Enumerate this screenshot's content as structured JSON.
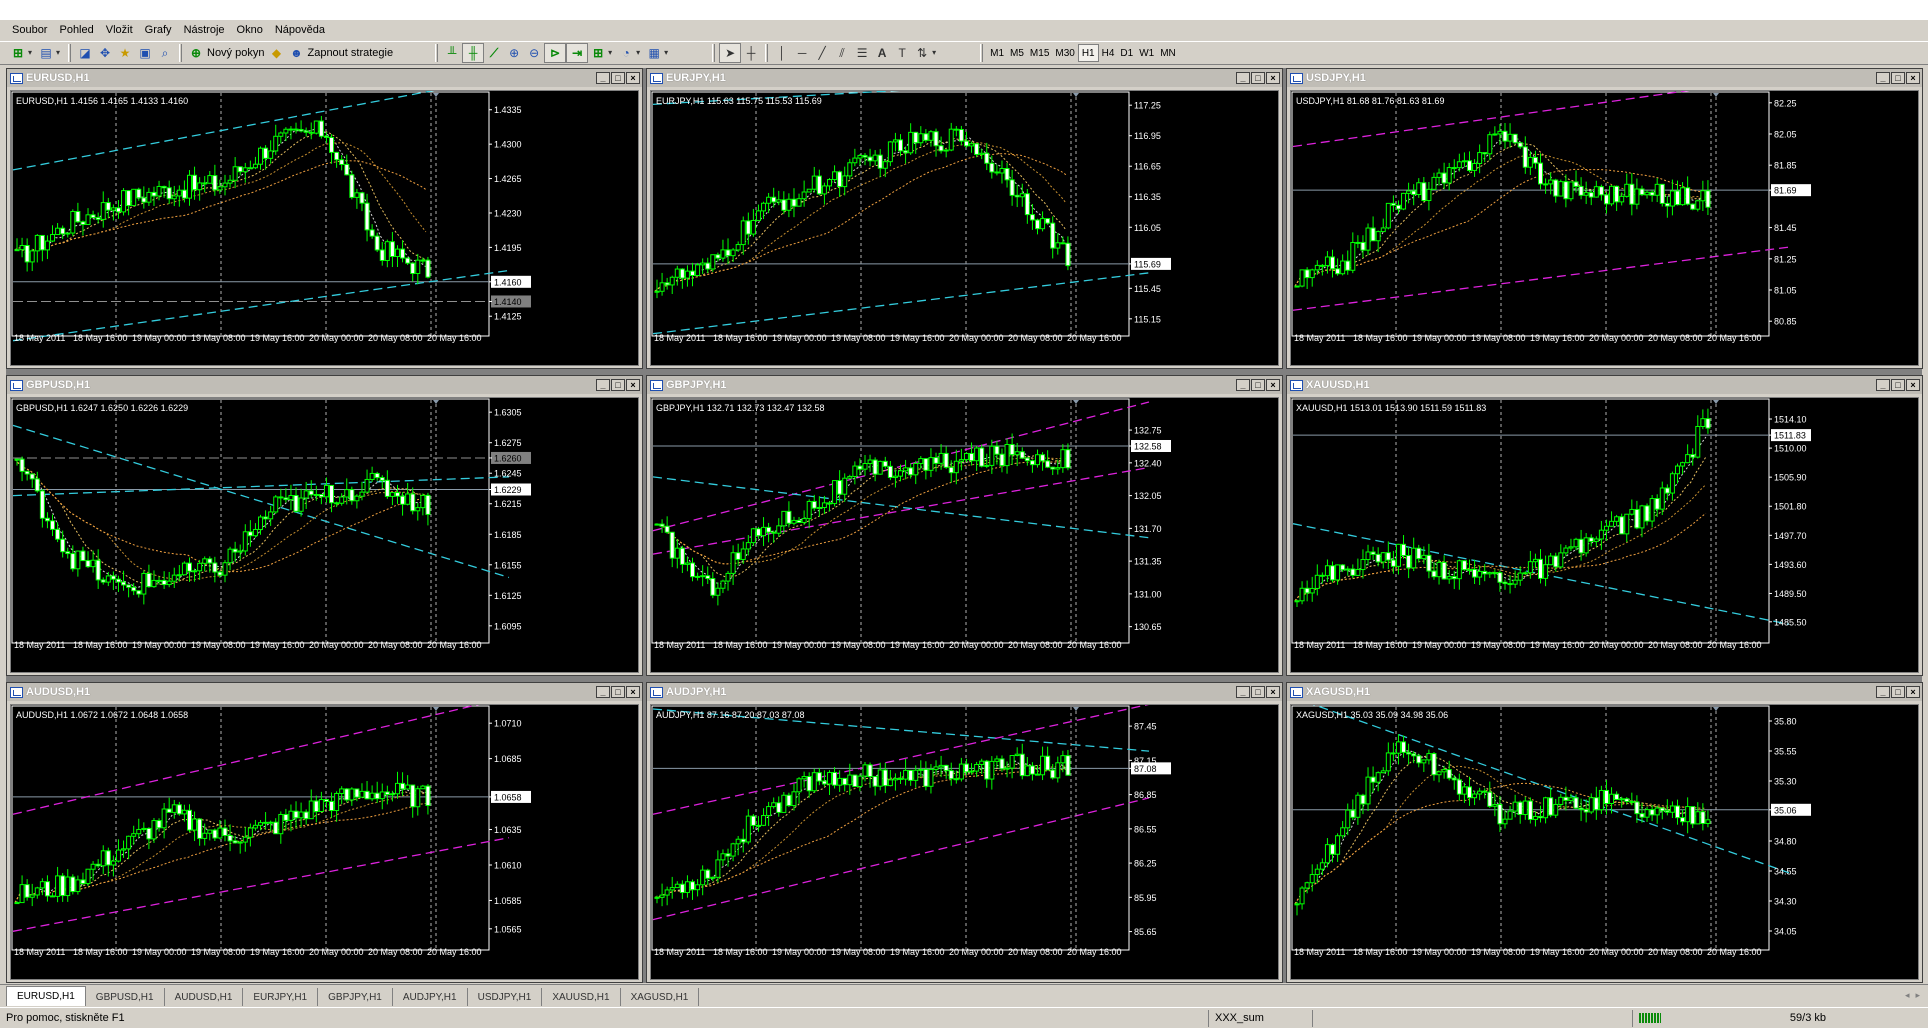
{
  "menu": [
    "Soubor",
    "Pohled",
    "Vložit",
    "Grafy",
    "Nástroje",
    "Okno",
    "Nápověda"
  ],
  "toolbar": {
    "new_order_label": "Nový pokyn",
    "strategies_label": "Zapnout strategie",
    "timeframes": [
      "M1",
      "M5",
      "M15",
      "M30",
      "H1",
      "H4",
      "D1",
      "W1",
      "MN"
    ],
    "active_timeframe": "H1"
  },
  "charts": [
    {
      "name": "EURUSD,H1",
      "header": "EURUSD,H1  1.4156 1.4165 1.4133 1.4160",
      "price_labels": [
        "1.4335",
        "1.4300",
        "1.4265",
        "1.4230",
        "1.4195",
        "1.4160",
        "1.4140",
        "1.4125"
      ],
      "current": "1.4160",
      "marker": "1.4140",
      "ymin": 1.4112,
      "ymax": 1.435,
      "trend": [
        0.3,
        0.45,
        0.55,
        0.6,
        0.62,
        0.8,
        0.85,
        0.35,
        0.25
      ],
      "lines": [
        {
          "type": "cyan",
          "y0": 0.68,
          "y1": 1.08
        },
        {
          "type": "cyan",
          "y0": -0.05,
          "y1": 0.25
        }
      ],
      "dates": [
        "18 May 2011",
        "18 May 16:00",
        "19 May 00:00",
        "19 May 08:00",
        "19 May 16:00",
        "20 May 00:00",
        "20 May 08:00",
        "20 May 16:00"
      ]
    },
    {
      "name": "EURJPY,H1",
      "header": "EURJPY,H1  115.63 115.75 115.53 115.69",
      "price_labels": [
        "117.25",
        "116.95",
        "116.65",
        "116.35",
        "116.05",
        "115.69",
        "115.45",
        "115.15"
      ],
      "current": "115.69",
      "marker": "",
      "ymin": 115.05,
      "ymax": 117.35,
      "trend": [
        0.2,
        0.25,
        0.5,
        0.6,
        0.7,
        0.8,
        0.82,
        0.6,
        0.3
      ],
      "lines": [
        {
          "type": "cyan",
          "y0": -0.02,
          "y1": 0.24
        },
        {
          "type": "cyan",
          "y0": 0.96,
          "y1": 1.08
        }
      ],
      "dates": [
        "18 May 2011",
        "18 May 16:00",
        "19 May 00:00",
        "19 May 08:00",
        "19 May 16:00",
        "20 May 00:00",
        "20 May 08:00",
        "20 May 16:00"
      ]
    },
    {
      "name": "USDJPY,H1",
      "header": "USDJPY,H1  81.68 81.76 81.63 81.69",
      "price_labels": [
        "82.25",
        "82.05",
        "81.85",
        "81.69",
        "81.45",
        "81.25",
        "81.05",
        "80.85"
      ],
      "current": "81.69",
      "marker": "",
      "ymin": 80.8,
      "ymax": 82.3,
      "trend": [
        0.2,
        0.3,
        0.55,
        0.65,
        0.85,
        0.6,
        0.58,
        0.57,
        0.55
      ],
      "lines": [
        {
          "type": "magenta",
          "y0": 0.78,
          "y1": 1.08
        },
        {
          "type": "magenta",
          "y0": 0.08,
          "y1": 0.35
        }
      ],
      "dates": [
        "18 May 2011",
        "18 May 16:00",
        "19 May 00:00",
        "19 May 08:00",
        "19 May 16:00",
        "20 May 00:00",
        "20 May 08:00",
        "20 May 16:00"
      ]
    },
    {
      "name": "GBPUSD,H1",
      "header": "GBPUSD,H1  1.6247 1.6250 1.6226 1.6229",
      "price_labels": [
        "1.6305",
        "1.6275",
        "1.6260",
        "1.6245",
        "1.6229",
        "1.6215",
        "1.6185",
        "1.6155",
        "1.6125",
        "1.6095"
      ],
      "current": "1.6229",
      "marker": "1.6260",
      "ymin": 1.6085,
      "ymax": 1.6315,
      "trend": [
        0.75,
        0.35,
        0.2,
        0.25,
        0.3,
        0.55,
        0.6,
        0.65,
        0.55
      ],
      "lines": [
        {
          "type": "cyan",
          "y0": 0.6,
          "y1": 0.68
        },
        {
          "type": "cyan",
          "y0": 0.9,
          "y1": 0.25
        }
      ],
      "dates": [
        "18 May 2011",
        "18 May 16:00",
        "19 May 00:00",
        "19 May 08:00",
        "19 May 16:00",
        "20 May 00:00",
        "20 May 08:00",
        "20 May 16:00"
      ]
    },
    {
      "name": "GBPJPY,H1",
      "header": "GBPJPY,H1  132.71 132.73 132.47 132.58",
      "price_labels": [
        "132.75",
        "132.58",
        "132.40",
        "132.05",
        "131.70",
        "131.35",
        "131.00",
        "130.65"
      ],
      "current": "132.58",
      "marker": "",
      "ymin": 130.55,
      "ymax": 133.05,
      "trend": [
        0.45,
        0.2,
        0.45,
        0.55,
        0.7,
        0.72,
        0.75,
        0.78,
        0.75
      ],
      "lines": [
        {
          "type": "magenta",
          "y0": 0.45,
          "y1": 1.0
        },
        {
          "type": "magenta",
          "y0": 0.35,
          "y1": 0.72
        },
        {
          "type": "cyan",
          "y0": 0.68,
          "y1": 0.42
        }
      ],
      "dates": [
        "18 May 2011",
        "18 May 16:00",
        "19 May 00:00",
        "19 May 08:00",
        "19 May 16:00",
        "20 May 00:00",
        "20 May 08:00",
        "20 May 16:00"
      ]
    },
    {
      "name": "XAUUSD,H1",
      "header": "XAUUSD,H1  1513.01 1513.90 1511.59 1511.83",
      "price_labels": [
        "1514.10",
        "1511.83",
        "1510.00",
        "1505.90",
        "1501.80",
        "1497.70",
        "1493.60",
        "1489.50",
        "1485.50"
      ],
      "current": "1511.83",
      "marker": "",
      "ymin": 1483.5,
      "ymax": 1516.5,
      "trend": [
        0.2,
        0.3,
        0.35,
        0.28,
        0.25,
        0.3,
        0.45,
        0.55,
        0.92
      ],
      "lines": [
        {
          "type": "cyan",
          "y0": 0.48,
          "y1": 0.05
        }
      ],
      "dates": [
        "18 May 2011",
        "18 May 16:00",
        "19 May 00:00",
        "19 May 08:00",
        "19 May 16:00",
        "20 May 00:00",
        "20 May 08:00",
        "20 May 16:00"
      ]
    },
    {
      "name": "AUDUSD,H1",
      "header": "AUDUSD,H1  1.0672 1.0672 1.0648 1.0658",
      "price_labels": [
        "1.0710",
        "1.0685",
        "1.0658",
        "1.0635",
        "1.0610",
        "1.0585",
        "1.0565"
      ],
      "current": "1.0658",
      "marker": "",
      "ymin": 1.0555,
      "ymax": 1.072,
      "trend": [
        0.2,
        0.25,
        0.4,
        0.55,
        0.45,
        0.5,
        0.6,
        0.65,
        0.62
      ],
      "lines": [
        {
          "type": "magenta",
          "y0": 0.55,
          "y1": 1.05
        },
        {
          "type": "magenta",
          "y0": 0.05,
          "y1": 0.45
        }
      ],
      "dates": [
        "18 May 2011",
        "18 May 16:00",
        "19 May 00:00",
        "19 May 08:00",
        "19 May 16:00",
        "20 May 00:00",
        "20 May 08:00",
        "20 May 16:00"
      ]
    },
    {
      "name": "AUDJPY,H1",
      "header": "AUDJPY,H1  87.16 87.20 87.03 87.08",
      "price_labels": [
        "87.45",
        "87.15",
        "87.08",
        "86.85",
        "86.55",
        "86.25",
        "85.95",
        "85.65"
      ],
      "current": "87.08",
      "marker": "",
      "ymin": 85.55,
      "ymax": 87.6,
      "trend": [
        0.2,
        0.3,
        0.55,
        0.7,
        0.72,
        0.7,
        0.74,
        0.76,
        0.75
      ],
      "lines": [
        {
          "type": "cyan",
          "y0": 1.0,
          "y1": 0.82
        },
        {
          "type": "magenta",
          "y0": 0.55,
          "y1": 1.02
        },
        {
          "type": "magenta",
          "y0": 0.1,
          "y1": 0.62
        }
      ],
      "dates": [
        "18 May 2011",
        "18 May 16:00",
        "19 May 00:00",
        "19 May 08:00",
        "19 May 16:00",
        "20 May 00:00",
        "20 May 08:00",
        "20 May 16:00"
      ]
    },
    {
      "name": "XAGUSD,H1",
      "header": "XAGUSD,H1  35.03 35.09 34.98 35.06",
      "price_labels": [
        "35.80",
        "35.55",
        "35.30",
        "35.06",
        "34.80",
        "34.55",
        "34.30",
        "34.05"
      ],
      "current": "35.06",
      "marker": "",
      "ymin": 33.95,
      "ymax": 35.9,
      "trend": [
        0.15,
        0.55,
        0.85,
        0.7,
        0.55,
        0.58,
        0.62,
        0.55,
        0.56
      ],
      "lines": [
        {
          "type": "cyan",
          "y0": 1.05,
          "y1": 0.3
        }
      ],
      "dates": [
        "18 May 2011",
        "18 May 16:00",
        "19 May 00:00",
        "19 May 08:00",
        "19 May 16:00",
        "20 May 00:00",
        "20 May 08:00",
        "20 May 16:00"
      ]
    }
  ],
  "tabs": [
    "EURUSD,H1",
    "GBPUSD,H1",
    "AUDUSD,H1",
    "EURJPY,H1",
    "GBPJPY,H1",
    "AUDJPY,H1",
    "USDJPY,H1",
    "XAUUSD,H1",
    "XAGUSD,H1"
  ],
  "active_tab": "EURUSD,H1",
  "status": {
    "help": "Pro pomoc, stiskněte F1",
    "profile": "XXX_sum",
    "traffic": "59/3 kb"
  },
  "colors": {
    "candle": "#00ff00",
    "background": "#000000",
    "grid": "#808080",
    "cyan_line": "#33ccdd",
    "magenta_line": "#dd22dd",
    "price_line": "#8a9aa8"
  }
}
